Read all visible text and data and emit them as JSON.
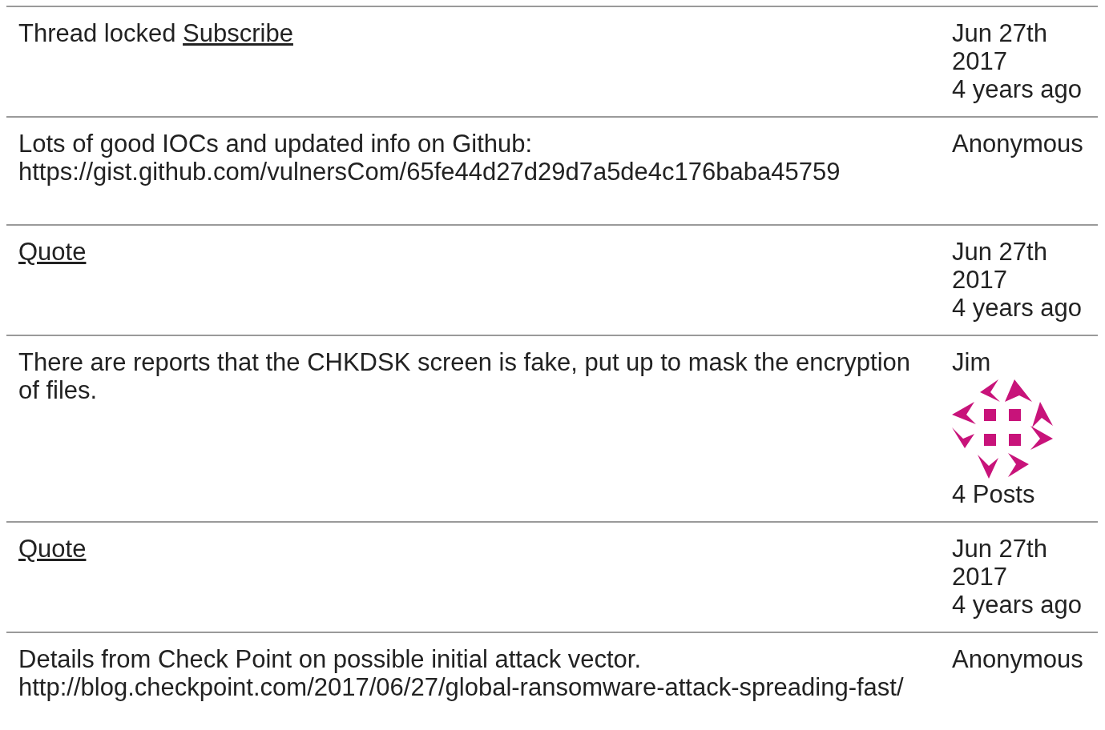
{
  "rows": [
    {
      "kind": "meta",
      "text": "Thread locked",
      "links": [
        "Subscribe"
      ],
      "date": "Jun 27th",
      "year": "2017",
      "age": "4 years ago"
    },
    {
      "kind": "post",
      "lines": [
        "Lots of good IOCs and updated info on Github:",
        "https://gist.github.com/vulnersCom/65fe44d27d29d7a5de4c176baba45759"
      ],
      "author": "Anonymous",
      "avatar": false
    },
    {
      "kind": "meta",
      "links": [
        "Quote"
      ],
      "date": "Jun 27th",
      "year": "2017",
      "age": "4 years ago"
    },
    {
      "kind": "post",
      "lines": [
        "There are reports that the CHKDSK screen is fake, put up to mask the encryption of files."
      ],
      "author": "Jim",
      "avatar": true,
      "posts": "4 Posts"
    },
    {
      "kind": "meta",
      "links": [
        "Quote"
      ],
      "date": "Jun 27th",
      "year": "2017",
      "age": "4 years ago"
    },
    {
      "kind": "post",
      "lines": [
        "Details from Check Point on possible initial attack vector.",
        "http://blog.checkpoint.com/2017/06/27/global-ransomware-attack-spreading-fast/"
      ],
      "author": "Anonymous",
      "avatar": false
    }
  ]
}
